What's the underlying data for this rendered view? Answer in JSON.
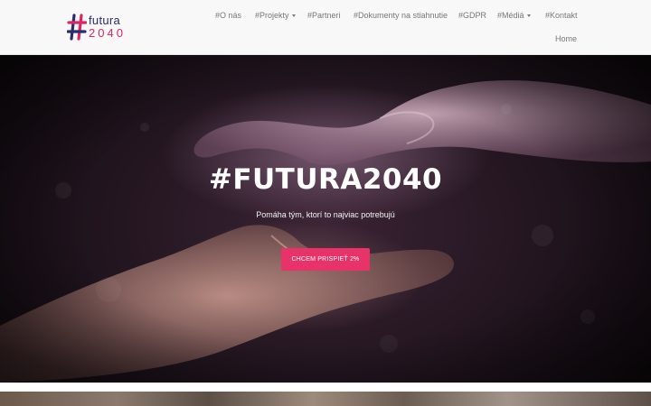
{
  "brand": {
    "logo_word": "futura",
    "logo_number": "2040",
    "colors": {
      "navy": "#2b2d6e",
      "pink": "#e0245e"
    }
  },
  "nav": {
    "items": [
      {
        "label": "#O nás",
        "has_dropdown": false
      },
      {
        "label": "#Projekty",
        "has_dropdown": true
      },
      {
        "label": "#Partneri",
        "has_dropdown": false
      },
      {
        "label": "#Dokumenty na stiahnutie",
        "has_dropdown": false
      },
      {
        "label": "#GDPR",
        "has_dropdown": false
      },
      {
        "label": "#Médiá",
        "has_dropdown": true
      },
      {
        "label": "#Kontakt",
        "has_dropdown": false
      }
    ],
    "home_label": "Home"
  },
  "hero": {
    "title": "#FUTURA2040",
    "subtitle": "Pomáha tým, ktorí to najviac potrebujú",
    "cta_label": "CHCEM PRISPIEŤ 2%",
    "cta_color": "#e8336a"
  }
}
